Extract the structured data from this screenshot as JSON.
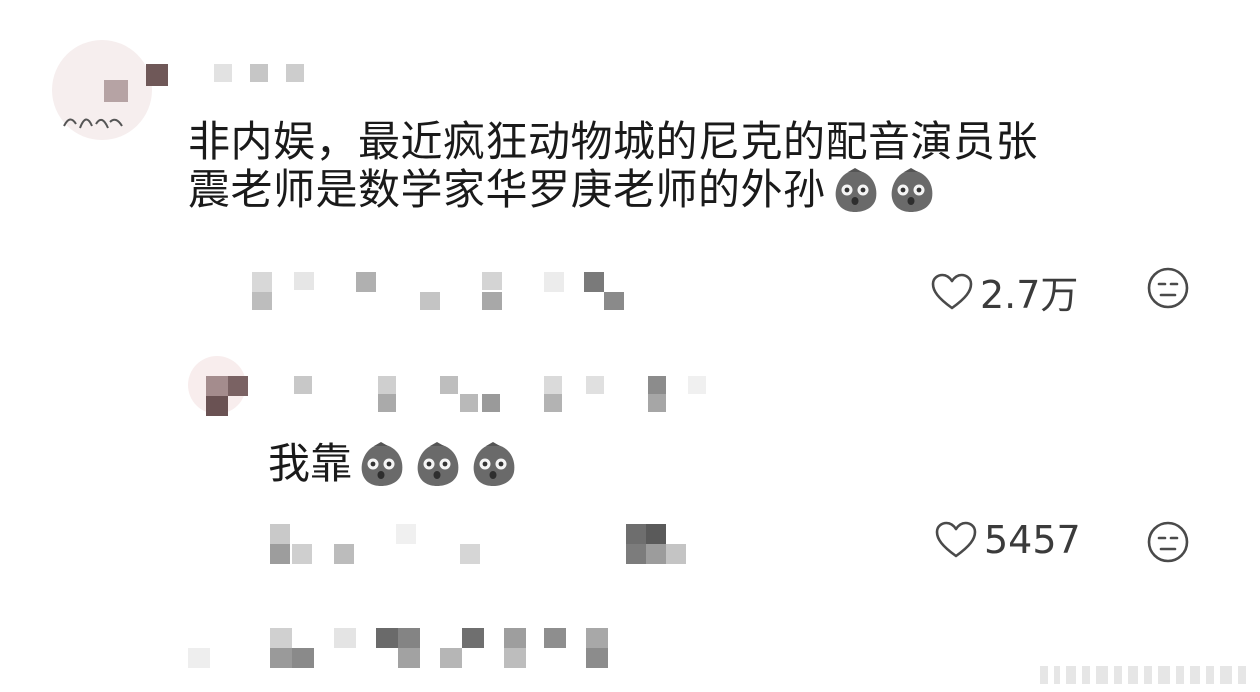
{
  "comment": {
    "author": "",
    "text_line1": "非内娱，最近疯狂动物城的尼克的配音演员张",
    "text_line2": "震老师是数学家华罗庚老师的外孙",
    "stickers": [
      "shocked-face-sticker",
      "shocked-face-sticker"
    ],
    "likes": "2.7万",
    "emoji_reaction_icon": "neutral-face-icon"
  },
  "reply": {
    "author": "",
    "text": "我靠",
    "stickers": [
      "shocked-face-sticker",
      "shocked-face-sticker",
      "shocked-face-sticker"
    ],
    "likes": "5457",
    "emoji_reaction_icon": "neutral-face-icon"
  },
  "colors": {
    "text": "#1a1a1a",
    "meta_gray": "#3b3b3b",
    "sticker_gray": "#6a6a6a",
    "background": "#ffffff"
  }
}
